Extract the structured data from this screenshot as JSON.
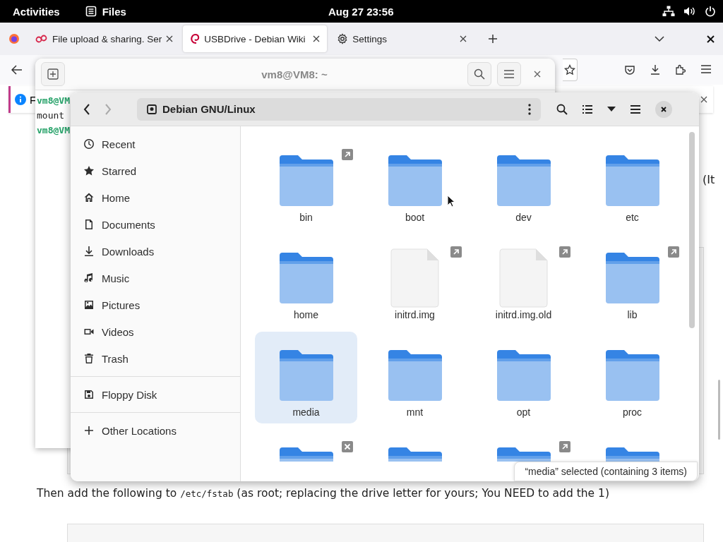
{
  "top_bar": {
    "activities": "Activities",
    "app": "Files",
    "clock": "Aug 27  23:56"
  },
  "browser": {
    "tabs": [
      {
        "label": "File upload & sharing. Ser",
        "selected": false,
        "kind": "share"
      },
      {
        "label": "USBDrive - Debian Wiki",
        "selected": true,
        "kind": "debian"
      },
      {
        "label": "Settings",
        "selected": false,
        "kind": "gear"
      }
    ],
    "notification": {
      "text": "F"
    },
    "page": {
      "side_text": "(It",
      "paragraph": {
        "before": "Then add the following to ",
        "code": "/etc/fstab",
        "after": " (as root; replacing the drive letter for yours; You NEED to add the 1)"
      }
    }
  },
  "terminal": {
    "title": "vm8@VM8: ~",
    "lines": [
      {
        "kind": "prompt",
        "text": "vm8@VM"
      },
      {
        "kind": "command",
        "text": "mount"
      },
      {
        "kind": "prompt",
        "text": "vm8@VM"
      }
    ]
  },
  "files": {
    "path": "Debian GNU/Linux",
    "sidebar": [
      [
        {
          "label": "Recent",
          "kind": "recent"
        },
        {
          "label": "Starred",
          "kind": "starred"
        },
        {
          "label": "Home",
          "kind": "home"
        },
        {
          "label": "Documents",
          "kind": "documents"
        },
        {
          "label": "Downloads",
          "kind": "downloads"
        },
        {
          "label": "Music",
          "kind": "music"
        },
        {
          "label": "Pictures",
          "kind": "pictures"
        },
        {
          "label": "Videos",
          "kind": "videos"
        },
        {
          "label": "Trash",
          "kind": "trash"
        }
      ],
      [
        {
          "label": "Floppy Disk",
          "kind": "floppy"
        }
      ],
      [
        {
          "label": "Other Locations",
          "kind": "other"
        }
      ]
    ],
    "items": [
      {
        "label": "bin",
        "kind": "folder",
        "symlink": true,
        "broken": false,
        "selected": false
      },
      {
        "label": "boot",
        "kind": "folder",
        "symlink": false,
        "broken": false,
        "selected": false
      },
      {
        "label": "dev",
        "kind": "folder",
        "symlink": false,
        "broken": false,
        "selected": false
      },
      {
        "label": "etc",
        "kind": "folder",
        "symlink": false,
        "broken": false,
        "selected": false
      },
      {
        "label": "home",
        "kind": "folder",
        "symlink": false,
        "broken": false,
        "selected": false
      },
      {
        "label": "initrd.img",
        "kind": "file",
        "symlink": true,
        "broken": false,
        "selected": false
      },
      {
        "label": "initrd.img.old",
        "kind": "file",
        "symlink": true,
        "broken": false,
        "selected": false
      },
      {
        "label": "lib",
        "kind": "folder",
        "symlink": true,
        "broken": false,
        "selected": false
      },
      {
        "label": "media",
        "kind": "folder",
        "symlink": false,
        "broken": false,
        "selected": true
      },
      {
        "label": "mnt",
        "kind": "folder",
        "symlink": false,
        "broken": false,
        "selected": false
      },
      {
        "label": "opt",
        "kind": "folder",
        "symlink": false,
        "broken": false,
        "selected": false
      },
      {
        "label": "proc",
        "kind": "folder",
        "symlink": false,
        "broken": false,
        "selected": false
      },
      {
        "kind": "folder",
        "symlink": false,
        "broken": true,
        "selected": false
      },
      {
        "kind": "folder",
        "symlink": false,
        "broken": false,
        "selected": false
      },
      {
        "kind": "folder",
        "symlink": true,
        "broken": false,
        "selected": false
      },
      {
        "kind": "folder",
        "symlink": false,
        "broken": false,
        "selected": false
      }
    ],
    "status": "“media” selected  (containing 3 items)"
  }
}
